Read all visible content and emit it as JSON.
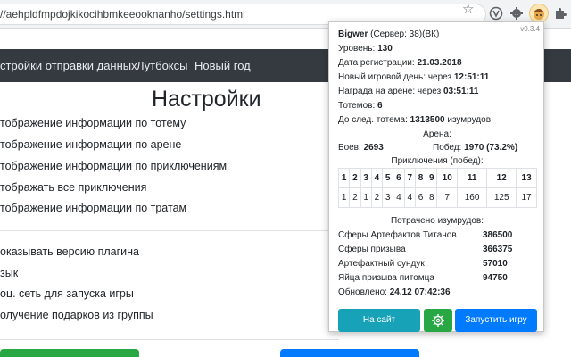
{
  "browser": {
    "url": "//aehpldfmpdojkikocihbmkeeooknanho/settings.html",
    "bookmark_icon": "star-outline-icon",
    "extension_icons": [
      "extension-icon",
      "gear-icon",
      "game-avatar-icon",
      "puzzle-icon"
    ]
  },
  "nav": {
    "items": [
      {
        "label": "стройки отправки данных"
      },
      {
        "label": "Лутбоксы"
      },
      {
        "label": "Новый год"
      }
    ]
  },
  "page": {
    "title": "Настройки",
    "settings": [
      {
        "label": "тображение информации по тотему"
      },
      {
        "label": "тображение информации по арене"
      },
      {
        "label": "тображение информации по приключениям"
      },
      {
        "label": "тображать все приключения"
      },
      {
        "label": "тображение информации по тратам"
      },
      {
        "label": "оказывать версию плагина"
      },
      {
        "label": "зык"
      },
      {
        "label": "оц. сеть для запуска игры"
      },
      {
        "label": "олучение подарков из группы"
      }
    ]
  },
  "popup": {
    "version": "v0.3.4",
    "player_name": "Bigwer",
    "server": "(Сервер: 38)(ВК)",
    "level_label": "Уровень:",
    "level": "130",
    "reg_label": "Дата регистрации:",
    "reg_date": "21.03.2018",
    "newday_label": "Новый игровой день: через",
    "newday_time": "12:51:11",
    "arena_reward_label": "Награда на арене: через",
    "arena_reward_time": "03:51:11",
    "totems_label": "Тотемов:",
    "totems": "6",
    "next_totem_label": "До след. тотема:",
    "next_totem_value": "1313500",
    "next_totem_unit": "изумрудов",
    "arena_header": "Арена:",
    "battles_label": "Боев:",
    "battles": "2693",
    "wins_label": "Побед:",
    "wins": "1970 (73.2%)",
    "adventures_header": "Приключения (побед):",
    "adventures": {
      "numbers": [
        "1",
        "2",
        "3",
        "4",
        "5",
        "6",
        "7",
        "8",
        "9",
        "10",
        "11",
        "12",
        "13"
      ],
      "wins": [
        "1",
        "2",
        "1",
        "2",
        "3",
        "4",
        "4",
        "6",
        "8",
        "7",
        "160",
        "125",
        "17"
      ]
    },
    "spent_header": "Потрачено изумрудов:",
    "spent": [
      {
        "name": "Сферы Артефактов Титанов",
        "value": "386500"
      },
      {
        "name": "Сферы призыва",
        "value": "366375"
      },
      {
        "name": "Артефактный сундук",
        "value": "57010"
      },
      {
        "name": "Яйца призыва питомца",
        "value": "94750"
      }
    ],
    "updated_label": "Обновлено:",
    "updated": "24.12 07:42:36",
    "btn_site": "На сайт",
    "btn_settings_icon": "gear-icon",
    "btn_launch": "Запустить игру"
  },
  "colors": {
    "nav_bg": "#343a40",
    "btn_site": "#17a2b8",
    "btn_settings": "#28a745",
    "btn_launch": "#007bff"
  }
}
